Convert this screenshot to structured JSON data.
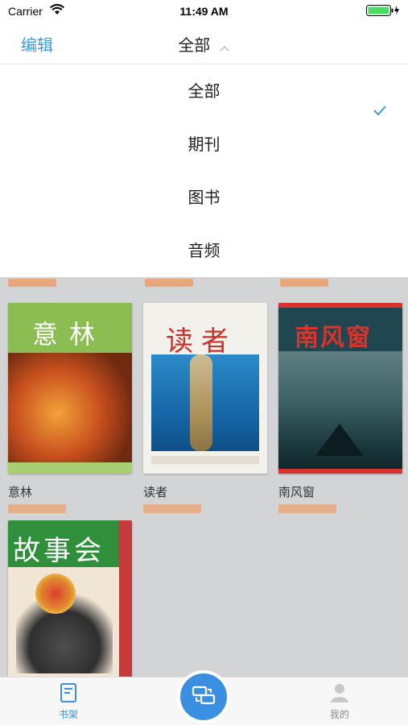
{
  "status_bar": {
    "carrier": "Carrier",
    "time": "11:49 AM"
  },
  "nav": {
    "edit_label": "编辑",
    "title": "全部"
  },
  "filter_menu": {
    "options": [
      {
        "label": "全部",
        "selected": true
      },
      {
        "label": "期刊",
        "selected": false
      },
      {
        "label": "图书",
        "selected": false
      },
      {
        "label": "音频",
        "selected": false
      }
    ]
  },
  "books": [
    {
      "title": "意林",
      "cover_text": "意林"
    },
    {
      "title": "读者",
      "cover_text": "读者"
    },
    {
      "title": "南风窗",
      "cover_text": "南风窗"
    },
    {
      "title": "",
      "cover_text": "故事会"
    }
  ],
  "tab_bar": {
    "shelf_label": "书架",
    "mine_label": "我的"
  },
  "colors": {
    "accent": "#3a8fe0",
    "edit_blue": "#3a9bdc",
    "check_blue": "#3a9bdc",
    "background_gray": "#d3d4d6"
  }
}
